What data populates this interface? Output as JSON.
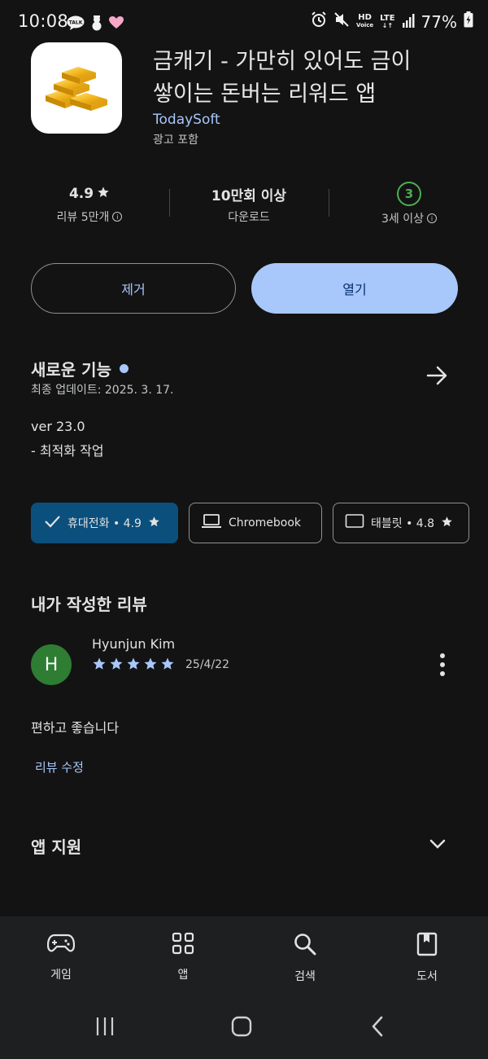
{
  "status_bar": {
    "time": "10:08",
    "left_icons": [
      "talk-icon",
      "snowman-icon",
      "heart-icon"
    ],
    "right_icons": [
      "alarm-icon",
      "mute-icon",
      "hd-voice-icon",
      "lte-icon",
      "signal-icon",
      "battery-icon"
    ],
    "battery": "77%",
    "talk_label": "TALK",
    "hd_label": "HD",
    "voice_label": "Voice",
    "lte_label": "LTE"
  },
  "app": {
    "title_line1": "금캐기 - 가만히 있어도 금이",
    "title_line2": "쌓이는 돈버는 리워드 앱",
    "developer": "TodaySoft",
    "ads_note": "광고 포함",
    "icon": "gold-bars-icon"
  },
  "stats": {
    "rating": "4.9",
    "reviews": "리뷰 5만개",
    "downloads": "10만회 이상",
    "downloads_label": "다운로드",
    "age_rating": "3",
    "age_label": "3세 이상"
  },
  "actions": {
    "remove": "제거",
    "open": "열기"
  },
  "whats_new": {
    "title": "새로운 기능",
    "updated": "최종 업데이트: 2025. 3. 17.",
    "version": "ver 23.0",
    "note": "- 최적화 작업"
  },
  "device_chips": [
    {
      "label": "휴대전화 • 4.9",
      "icon": "check-icon",
      "selected": true
    },
    {
      "label": "Chromebook",
      "icon": "laptop-icon",
      "selected": false
    },
    {
      "label": "태블릿 • 4.8",
      "icon": "tablet-icon",
      "selected": false
    }
  ],
  "my_review": {
    "heading": "내가 작성한 리뷰",
    "avatar_letter": "H",
    "name": "Hyunjun Kim",
    "stars": 5,
    "date": "25/4/22",
    "text": "편하고 좋습니다",
    "edit": "리뷰 수정"
  },
  "support": {
    "title": "앱 지원"
  },
  "bottom_nav": [
    {
      "label": "게임",
      "icon": "gamepad-icon"
    },
    {
      "label": "앱",
      "icon": "apps-grid-icon"
    },
    {
      "label": "검색",
      "icon": "search-icon"
    },
    {
      "label": "도서",
      "icon": "book-icon"
    }
  ],
  "colors": {
    "background": "#131314",
    "accent": "#a8c7fa",
    "selected_chip": "#0b4f7c",
    "avatar": "#2e7d32",
    "age_badge": "#4caf50"
  }
}
